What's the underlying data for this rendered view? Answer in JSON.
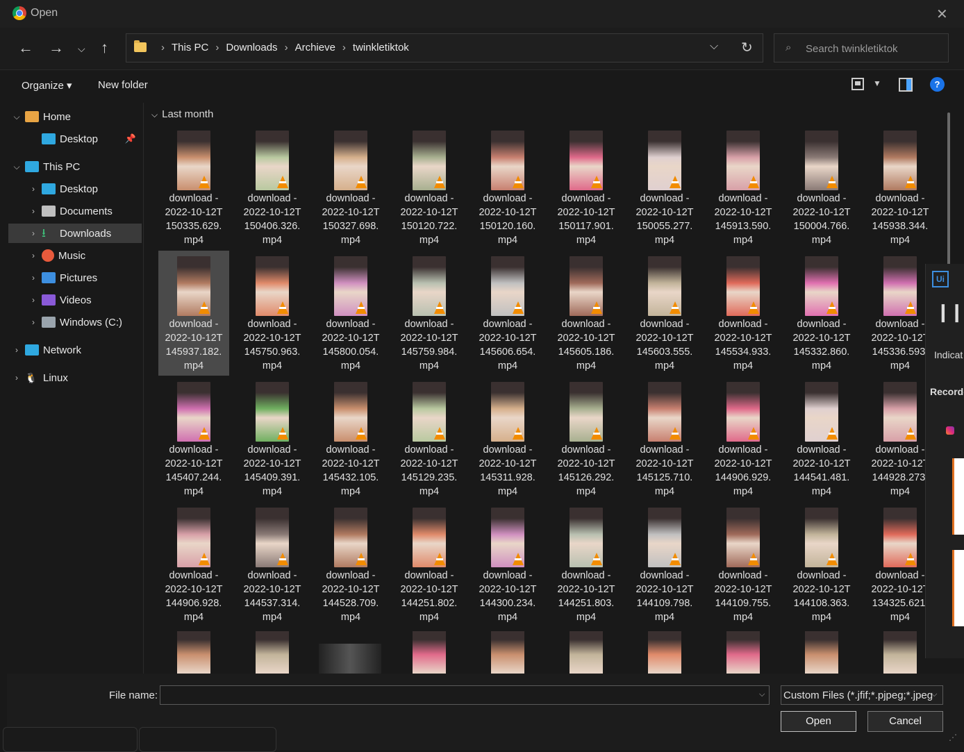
{
  "window": {
    "title": "Open"
  },
  "address": {
    "crumbs": [
      "This PC",
      "Downloads",
      "Archieve",
      "twinkletiktok"
    ]
  },
  "search": {
    "placeholder": "Search twinkletiktok"
  },
  "toolbar": {
    "organize": "Organize ▾",
    "new_folder": "New folder",
    "help": "?"
  },
  "sidebar": {
    "items": [
      {
        "label": "Home",
        "icon": "home-icon",
        "expanded": true
      },
      {
        "label": "Desktop",
        "icon": "desktop-icon",
        "pinned": true
      },
      {
        "label": "This PC",
        "icon": "pc-icon",
        "expanded": true
      },
      {
        "label": "Desktop",
        "icon": "desktop-icon"
      },
      {
        "label": "Documents",
        "icon": "documents-icon"
      },
      {
        "label": "Downloads",
        "icon": "downloads-icon",
        "selected": true
      },
      {
        "label": "Music",
        "icon": "music-icon"
      },
      {
        "label": "Pictures",
        "icon": "pictures-icon"
      },
      {
        "label": "Videos",
        "icon": "videos-icon"
      },
      {
        "label": "Windows (C:)",
        "icon": "drive-icon"
      },
      {
        "label": "Network",
        "icon": "network-icon"
      },
      {
        "label": "Linux",
        "icon": "linux-icon"
      }
    ]
  },
  "group": {
    "header": "Last month"
  },
  "files": [
    [
      "150335.629",
      "150406.326",
      "150327.698",
      "150120.722",
      "150120.160",
      "150117.901",
      "150055.277",
      "145913.590",
      "150004.766",
      "145938.344"
    ],
    [
      "145937.182",
      "145750.963",
      "145800.054",
      "145759.984",
      "145606.654",
      "145605.186",
      "145603.555",
      "145534.933",
      "145332.860",
      "145336.593"
    ],
    [
      "145407.244",
      "145409.391",
      "145432.105",
      "145129.235",
      "145311.928",
      "145126.292",
      "145125.710",
      "144906.929",
      "144541.481",
      "144928.273"
    ],
    [
      "144906.928",
      "144537.314",
      "144528.709",
      "144251.802",
      "144300.234",
      "144251.803",
      "144109.798",
      "144109.755",
      "144108.363",
      "134325.621"
    ]
  ],
  "file_prefix": "download -",
  "file_date": "2022-10-12T",
  "file_ext": "mp4",
  "overlay": {
    "logo": "Ui",
    "indicator": "Indicat",
    "recorder": "Recorde"
  },
  "bottom": {
    "filename_label": "File name:",
    "filename_value": "",
    "filetype": "Custom Files (*.jfif;*.pjpeg;*.jpeg",
    "open": "Open",
    "cancel": "Cancel"
  },
  "colors": {
    "background": "#191919",
    "accent": "#1a73e8",
    "vlc_orange": "#f28c00"
  }
}
